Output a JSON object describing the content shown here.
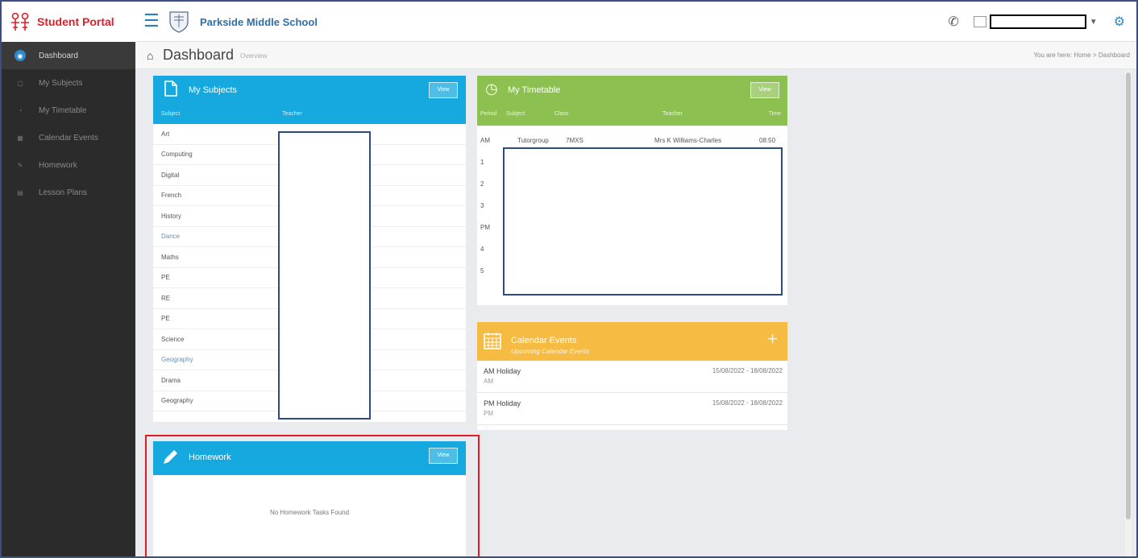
{
  "app": {
    "name": "Student Portal",
    "school": "Parkside Middle School",
    "icons": {
      "hamburger": "hamburger-icon",
      "phone": "phone-icon",
      "settings": "gear-icon",
      "home": "home-icon"
    }
  },
  "sidebar": {
    "items": [
      {
        "label": "Dashboard",
        "active": true,
        "icon": "dashboard-icon"
      },
      {
        "label": "My Subjects",
        "active": false,
        "icon": "subjects-icon"
      },
      {
        "label": "My Timetable",
        "active": false,
        "icon": "timetable-icon"
      },
      {
        "label": "Calendar Events",
        "active": false,
        "icon": "calendar-icon"
      },
      {
        "label": "Homework",
        "active": false,
        "icon": "homework-icon"
      },
      {
        "label": "Lesson Plans",
        "active": false,
        "icon": "lesson-plans-icon"
      }
    ]
  },
  "header": {
    "title": "Dashboard",
    "subtitle": "Overview",
    "breadcrumb": "You are here: Home > Dashboard"
  },
  "subjects": {
    "title": "My Subjects",
    "view_label": "View",
    "columns": [
      "Subject",
      "Teacher"
    ],
    "rows": [
      "Art",
      "Computing",
      "Digital",
      "French",
      "History",
      "Dance",
      "Maths",
      "PE",
      "RE",
      "PE",
      "Science",
      "Geography",
      "Drama",
      "Geography"
    ]
  },
  "timetable": {
    "title": "My Timetable",
    "view_label": "View",
    "columns": [
      "Period",
      "Subject",
      "Class",
      "Teacher",
      "Time"
    ],
    "first_row": {
      "period": "AM",
      "subject": "Tutorgroup",
      "class": "7MXS",
      "teacher": "Mrs K Williams-Charles",
      "time": "08:50"
    },
    "periods": [
      "1",
      "2",
      "3",
      "PM",
      "4",
      "5"
    ]
  },
  "calendar": {
    "title": "Calendar Events",
    "subtitle": "Upcoming Calendar Events",
    "events": [
      {
        "name": "AM Holiday",
        "code": "AM",
        "dates": "15/08/2022 - 18/08/2022"
      },
      {
        "name": "PM Holiday",
        "code": "PM",
        "dates": "15/08/2022 - 18/08/2022"
      }
    ]
  },
  "homework": {
    "title": "Homework",
    "view_label": "View",
    "empty": "No Homework Tasks Found"
  },
  "colors": {
    "brand_red": "#e11d2a",
    "blue": "#15a9df",
    "green": "#8cc152",
    "yellow": "#f6bb42",
    "sidebar": "#2b2b2b",
    "highlight": "#e31b23"
  }
}
